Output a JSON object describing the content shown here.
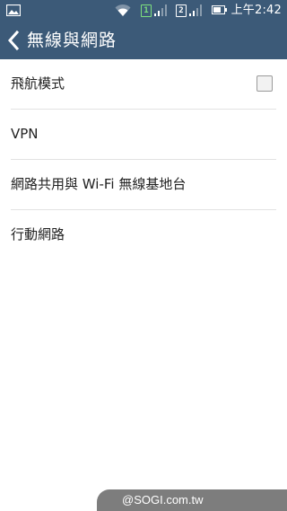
{
  "status_bar": {
    "icons": [
      "gallery-icon",
      "wifi-icon",
      "sim1-signal-icon",
      "sim2-signal-icon",
      "battery-icon"
    ],
    "sim1_label": "1",
    "sim2_label": "2",
    "time": "上午2:42",
    "sim1_color": "#7ee07e"
  },
  "action_bar": {
    "title": "無線與網路",
    "background": "#3c5a78",
    "back_icon": "chevron-left-icon"
  },
  "settings": {
    "items": [
      {
        "label": "飛航模式",
        "has_checkbox": true,
        "checked": false
      },
      {
        "label": "VPN"
      },
      {
        "label": "網路共用與 Wi-Fi 無線基地台"
      },
      {
        "label": "行動網路"
      }
    ]
  },
  "watermark": {
    "text": "@SOGI.com.tw"
  }
}
